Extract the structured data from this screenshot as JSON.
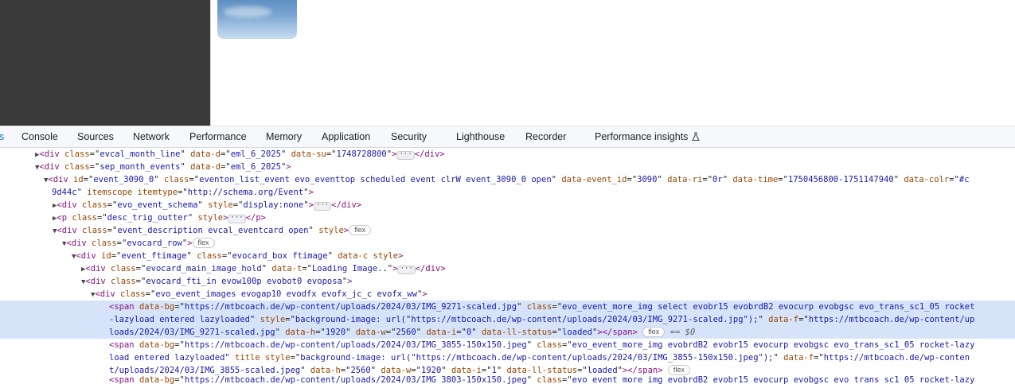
{
  "page": {
    "accent": "#1a73e8",
    "thumbnail_icon": "sky-image"
  },
  "devtools": {
    "tabs": [
      "s",
      "Console",
      "Sources",
      "Network",
      "Performance",
      "Memory",
      "Application",
      "Security",
      "Lighthouse",
      "Recorder",
      "Performance insights"
    ],
    "selected_tab": "s",
    "experimental_icon": "flask-icon"
  },
  "dom": {
    "l1": {
      "tag": "div",
      "a1n": "class",
      "a1v": "evcal_month_line",
      "a2n": "data-d",
      "a2v": "eml_6_2025",
      "a3n": "data-su",
      "a3v": "1748728800",
      "dots": "···"
    },
    "l2": {
      "tag": "div",
      "a1n": "class",
      "a1v": "sep_month_events",
      "a2n": "data-d",
      "a2v": "eml_6_2025"
    },
    "l3": {
      "tag": "div",
      "a1n": "id",
      "a1v": "event_3090_0",
      "a2n": "class",
      "a2v": "eventon_list_event evo_eventtop scheduled event clrW event_3090_0 open",
      "a3n": "data-event_id",
      "a3v": "3090",
      "a4n": "data-ri",
      "a4v": "0r",
      "a5n": "data-time",
      "a5v": "1750456800-1751147940",
      "a6n": "data-colr",
      "a6v": "#c",
      "cont": "9d44c\"",
      "a7n": "itemscope",
      "a8n": "itemtype",
      "a8v": "http://schema.org/Event"
    },
    "l4": {
      "tag": "div",
      "a1n": "class",
      "a1v": "evo_event_schema",
      "a2n": "style",
      "a2v": "display:none",
      "dots": "···"
    },
    "l5": {
      "tag": "p",
      "a1n": "class",
      "a1v": "desc_trig_outter",
      "a2n": "style",
      "dots": "···"
    },
    "l6": {
      "tag": "div",
      "a1n": "class",
      "a1v": "event_description evcal_eventcard open",
      "a2n": "style",
      "pill": "flex"
    },
    "l7": {
      "tag": "div",
      "a1n": "class",
      "a1v": "evocard_row",
      "pill": "flex"
    },
    "l8": {
      "tag": "div",
      "a1n": "id",
      "a1v": "event_ftimage",
      "a2n": "class",
      "a2v": "evocard_box ftimage",
      "a3n": "data-c",
      "a4n": "style"
    },
    "l9": {
      "tag": "div",
      "a1n": "class",
      "a1v": "evocard_main_image_hold",
      "a2n": "data-t",
      "a2v": "Loading Image..",
      "dots": "···"
    },
    "l10": {
      "tag": "div",
      "a1n": "class",
      "a1v": "evocard_fti_in evow100p evobot0 evoposa"
    },
    "l11": {
      "tag": "div",
      "a1n": "class",
      "a1v": "evo_event_images evogap10 evodfx evofx_jc_c evofx_ww"
    },
    "s1": {
      "tag": "span",
      "a1n": "data-bg",
      "a1v": "https://mtbcoach.de/wp-content/uploads/2024/03/IMG_9271-scaled.jpg",
      "a2n": "class",
      "a2v": "evo_event_more_img select evobr15 evobrdB2 evocurp evobgsc evo_trans_sc1_05 rocket",
      "c1": "-lazyload entered lazyloaded\"",
      "a3n": "style",
      "a3v": "background-image: url(\"https://mtbcoach.de/wp-content/uploads/2024/03/IMG_9271-scaled.jpg\");",
      "a4n": "data-f",
      "a4v": "https://mtbcoach.de/wp-content/up",
      "c2": "loads/2024/03/IMG_9271-scaled.jpg\"",
      "a5n": "data-h",
      "a5v": "1920",
      "a6n": "data-w",
      "a6v": "2560",
      "a7n": "data-i",
      "a7v": "0",
      "a8n": "data-ll-status",
      "a8v": "loaded",
      "pill": "flex",
      "eq": "==",
      "dollar": "$0"
    },
    "s2": {
      "tag": "span",
      "a1n": "data-bg",
      "a1v": "https://mtbcoach.de/wp-content/uploads/2024/03/IMG_3855-150x150.jpeg",
      "a2n": "class",
      "a2v": "evo_event_more_img evobrdB2 evobr15 evocurp evobgsc evo_trans_sc1_05 rocket-lazy",
      "c1": "load entered lazyloaded\"",
      "a3n": "title",
      "a4n": "style",
      "a4v": "background-image: url(\"https://mtbcoach.de/wp-content/uploads/2024/03/IMG_3855-150x150.jpeg\");",
      "a5n": "data-f",
      "a5v": "https://mtbcoach.de/wp-conten",
      "c2": "t/uploads/2024/03/IMG_3855-scaled.jpeg\"",
      "a6n": "data-h",
      "a6v": "2560",
      "a7n": "data-w",
      "a7v": "1920",
      "a8n": "data-i",
      "a8v": "1",
      "a9n": "data-ll-status",
      "a9v": "loaded",
      "pill": "flex"
    },
    "s3": {
      "tag": "span",
      "a1n": "data-bg",
      "a1v": "https://mtbcoach.de/wp-content/uploads/2024/03/IMG_3803-150x150.jpeg",
      "a2n": "class",
      "a2v": "evo_event_more_img evobrdB2 evobr15 evocurp evobgsc evo_trans_sc1_05 rocket-lazy"
    }
  }
}
